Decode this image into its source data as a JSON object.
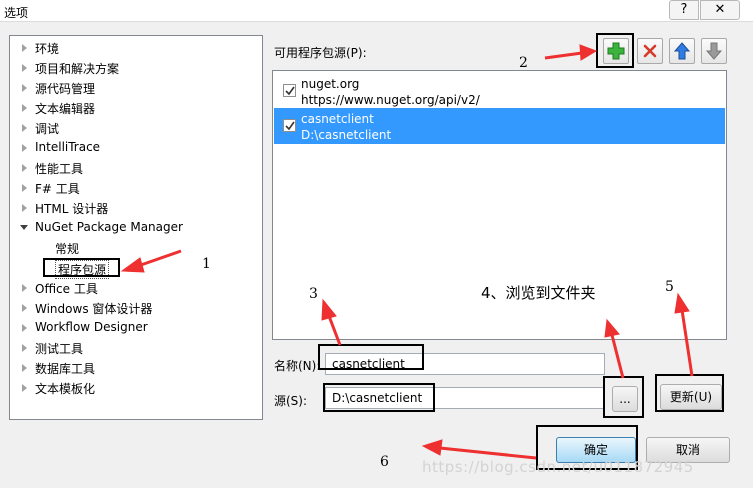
{
  "window": {
    "title": "选项",
    "help_label": "?",
    "close_label": "✕"
  },
  "tree": {
    "items": [
      {
        "label": "环境",
        "expanded": false
      },
      {
        "label": "项目和解决方案",
        "expanded": false
      },
      {
        "label": "源代码管理",
        "expanded": false
      },
      {
        "label": "文本编辑器",
        "expanded": false
      },
      {
        "label": "调试",
        "expanded": false
      },
      {
        "label": "IntelliTrace",
        "expanded": false
      },
      {
        "label": "性能工具",
        "expanded": false
      },
      {
        "label": "F# 工具",
        "expanded": false
      },
      {
        "label": "HTML 设计器",
        "expanded": false
      },
      {
        "label": "NuGet Package Manager",
        "expanded": true
      },
      {
        "label": "常规",
        "child": true
      },
      {
        "label": "程序包源",
        "child": true,
        "selected": true
      },
      {
        "label": "Office 工具",
        "expanded": false
      },
      {
        "label": "Windows 窗体设计器",
        "expanded": false
      },
      {
        "label": "Workflow Designer",
        "expanded": false
      },
      {
        "label": "测试工具",
        "expanded": false
      },
      {
        "label": "数据库工具",
        "expanded": false
      },
      {
        "label": "文本模板化",
        "expanded": false
      }
    ]
  },
  "sources": {
    "label": "可用程序包源(P):",
    "items": [
      {
        "name": "nuget.org",
        "url": "https://www.nuget.org/api/v2/",
        "checked": true,
        "selected": false
      },
      {
        "name": "casnetclient",
        "url": "D:\\casnetclient",
        "checked": true,
        "selected": true
      }
    ]
  },
  "toolbar": {
    "add_icon": "green-plus-icon",
    "remove_icon": "red-x-icon",
    "up_icon": "blue-up-arrow-icon",
    "down_icon": "gray-down-arrow-icon"
  },
  "form": {
    "name_label": "名称(N):",
    "name_value": "casnetclient",
    "source_label": "源(S):",
    "source_value": "D:\\casnetclient",
    "browse_label": "...",
    "update_label": "更新(U)"
  },
  "buttons": {
    "ok": "确定",
    "cancel": "取消"
  },
  "annotations": {
    "n1": "1",
    "n2": "2",
    "n3": "3",
    "n4_text": "4、浏览到文件夹",
    "n5": "5",
    "n6": "6"
  },
  "watermark": "https://blog.csdn.net/u011872945",
  "colors": {
    "selection": "#3399ff",
    "annotation_arrow": "#ee3030"
  }
}
